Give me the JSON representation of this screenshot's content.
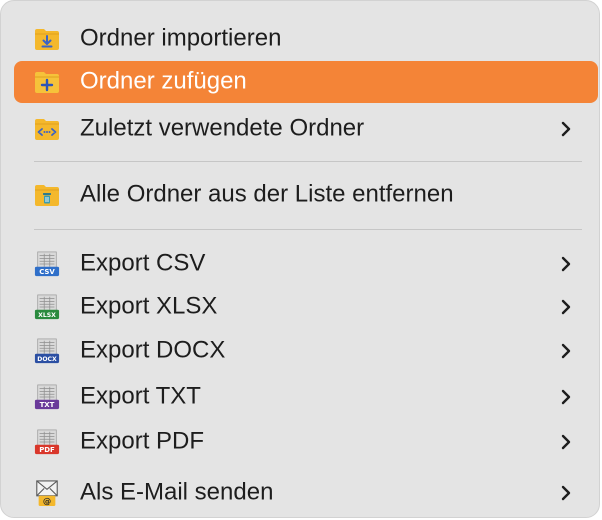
{
  "menu": {
    "items": [
      {
        "label": "Ordner importieren",
        "icon": "folder-import-icon",
        "submenu": false,
        "selected": false
      },
      {
        "label": "Ordner zufügen",
        "icon": "folder-add-icon",
        "submenu": false,
        "selected": true
      },
      {
        "label": "Zuletzt verwendete Ordner",
        "icon": "folder-recent-icon",
        "submenu": true,
        "selected": false
      },
      {
        "label": "Alle Ordner aus der Liste entfernen",
        "icon": "folder-trash-icon",
        "submenu": false,
        "selected": false
      },
      {
        "label": "Export CSV",
        "icon": "export-csv-icon",
        "icon_badge": "CSV",
        "submenu": true,
        "selected": false
      },
      {
        "label": "Export XLSX",
        "icon": "export-xlsx-icon",
        "icon_badge": "XLSX",
        "submenu": true,
        "selected": false
      },
      {
        "label": "Export DOCX",
        "icon": "export-docx-icon",
        "icon_badge": "DOCX",
        "submenu": true,
        "selected": false
      },
      {
        "label": "Export TXT",
        "icon": "export-txt-icon",
        "icon_badge": "TXT",
        "submenu": true,
        "selected": false
      },
      {
        "label": "Export PDF",
        "icon": "export-pdf-icon",
        "icon_badge": "PDF",
        "submenu": true,
        "selected": false
      },
      {
        "label": "Als E-Mail senden",
        "icon": "email-icon",
        "submenu": true,
        "selected": false
      }
    ]
  },
  "colors": {
    "menu_background": "#e4e4e4",
    "selection": "#f48437",
    "text": "#1d1d1d",
    "folder_yellow": "#f4b82c",
    "csv_badge": "#2f6fc9",
    "xlsx_badge": "#2a8a3e",
    "docx_badge": "#2b4fa3",
    "txt_badge": "#6a3a9a",
    "pdf_badge": "#d9372b"
  }
}
